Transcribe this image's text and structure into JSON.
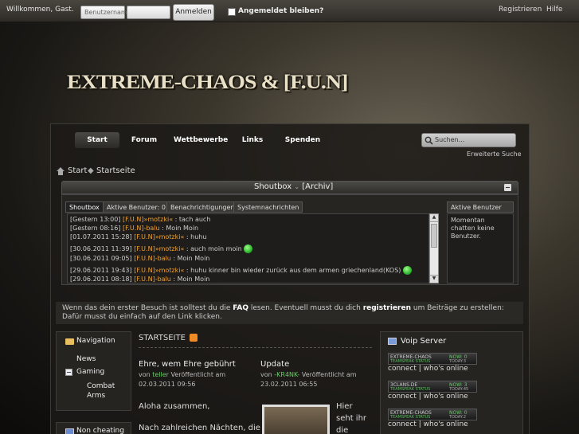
{
  "topbar": {
    "welcome": "Willkommen, Gast.",
    "username_placeholder": "Benutzername",
    "login_button": "Anmelden",
    "remember_label": "Angemeldet bleiben?",
    "register": "Registrieren",
    "help": "Hilfe"
  },
  "logo": "EXTREME-CHAOS & [F.U.N]",
  "nav": [
    "Start",
    "Forum",
    "Wettbewerbe",
    "Links",
    "Spenden"
  ],
  "search": {
    "placeholder": "Suchen...",
    "advanced": "Erweiterte Suche"
  },
  "breadcrumb": [
    "Start",
    "Startseite"
  ],
  "shoutbox": {
    "title": "Shoutbox",
    "archive": "[Archiv]",
    "tabs": [
      "Shoutbox",
      "Aktive Benutzer: 0",
      "Benachrichtigungen",
      "Systemnachrichten"
    ],
    "messages": [
      {
        "time": "[Gestern 13:00]",
        "user": "[F.U.N]»motzki«",
        "text": ": tach auch"
      },
      {
        "time": "[Gestern 08:16]",
        "user": "[F.U.N]-balu",
        "text": ": Moin Moin"
      },
      {
        "time": "[01.07.2011 15:28]",
        "user": "[F.U.N]»motzki«",
        "text": ": huhu"
      },
      {
        "time": "[30.06.2011 11:39]",
        "user": "[F.U.N]»motzki«",
        "text": ": auch moin moin"
      },
      {
        "time": "[30.06.2011 09:05]",
        "user": "[F.U.N]-balu",
        "text": ": Moin Moin"
      },
      {
        "time": "[29.06.2011 19:43]",
        "user": "[F.U.N]»motzki«",
        "text": ": huhu kinner bin wieder zurück aus dem armen griechenland(KOS)"
      },
      {
        "time": "[29.06.2011 08:18]",
        "user": "[F.U.N]-balu",
        "text": ": Moin Moin"
      }
    ],
    "active_users_title": "Aktive Benutzer",
    "active_users_text": "Momentan chatten keine Benutzer."
  },
  "notice": {
    "part1": "Wenn das dein erster Besuch ist solltest du die ",
    "faq": "FAQ",
    "part2": " lesen. Eventuell musst du dich ",
    "register": "registrieren",
    "part3": " um Beiträge zu erstellen: Dafür musst du einfach auf den Link klicken."
  },
  "sidebar": {
    "title": "Navigation",
    "items": [
      "News",
      "Gaming",
      "Combat Arms"
    ],
    "next_title": "Non cheating"
  },
  "center": {
    "title": "STARTSEITE",
    "articles": [
      {
        "title": "Ehre, wem Ehre gebührt",
        "by": "von",
        "author": "teller",
        "meta": "Veröffentlicht am 02.03.2011 09:56"
      },
      {
        "title": "Update",
        "by": "von",
        "author": "-KR4NK-",
        "meta": "Veröffentlicht am 23.02.2011 06:55"
      }
    ],
    "text1": "Aloha zusammen,",
    "text2": "Nach zahlreichen Nächten, die",
    "text3": "Hier seht ihr die neuen"
  },
  "voip": {
    "title": "Voip Server",
    "servers": [
      {
        "name": "EXTREME-CHAOS",
        "sub": "TEAMSPEAK STATUS",
        "now": "NOW: 0",
        "today": "TODAY:3"
      },
      {
        "name": "3CLANS.DE",
        "sub": "TEAMSPEAK STATUS",
        "now": "NOW: 3",
        "today": "TODAY:45"
      },
      {
        "name": "EXTREME-CHAOS",
        "sub": "TEAMSPEAK STATUS",
        "now": "NOW: 0",
        "today": "TODAY:2"
      }
    ],
    "connect": "connect | who's online"
  }
}
